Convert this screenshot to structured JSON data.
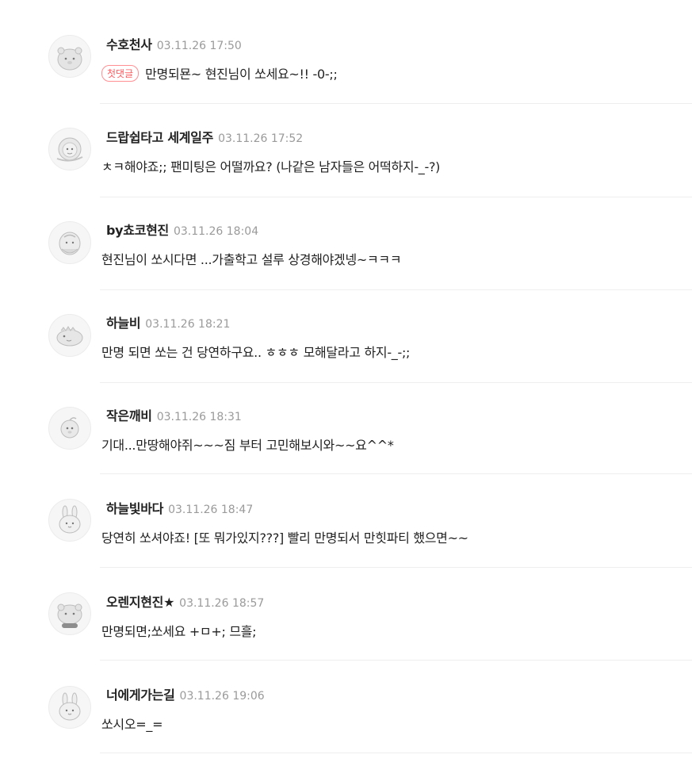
{
  "comments": [
    {
      "nickname": "수호천사",
      "date": "03.11.26 17:50",
      "badge": "첫댓글",
      "text": "만명되묜~ 현진님이 쏘세요~!! -0-;;",
      "avatar_icon": "bear-character-icon"
    },
    {
      "nickname": "드랍쉽타고 세계일주",
      "date": "03.11.26 17:52",
      "text": "ㅊㅋ해야죠;; 팬미팅은 어떨까요? (나같은 남자들은 어떡하지-_-?)",
      "avatar_icon": "lion-character-icon"
    },
    {
      "nickname": "by쵸코현진",
      "date": "03.11.26 18:04",
      "text": "현진님이 쏘시다면 ...가출학고 설루 상경해야겠넹~ㅋㅋㅋ",
      "avatar_icon": "old-man-character-icon"
    },
    {
      "nickname": "하늘비",
      "date": "03.11.26 18:21",
      "text": "만명 되면 쏘는 건 당연하구요.. ㅎㅎㅎ 모해달라고 하지-_-;;",
      "avatar_icon": "dinosaur-character-icon"
    },
    {
      "nickname": "작은깨비",
      "date": "03.11.26 18:31",
      "text": "기대...만땅해야쥐~~~짐 부터 고민해보시와~~요^^*",
      "avatar_icon": "peach-character-icon"
    },
    {
      "nickname": "하늘빛바다",
      "date": "03.11.26 18:47",
      "text": "당연히 쏘셔야죠! [또 뭐가있지???] 빨리 만명되서 만힛파티 했으면~~",
      "avatar_icon": "rabbit-character-icon"
    },
    {
      "nickname": "오렌지현진★",
      "date": "03.11.26 18:57",
      "text": "만명되면;쏘세요 +ㅁ+; 므흘;",
      "avatar_icon": "bear-character-icon"
    },
    {
      "nickname": "너에게가는길",
      "date": "03.11.26 19:06",
      "text": "쏘시오=_=",
      "avatar_icon": "rabbit-character-icon"
    }
  ],
  "colors": {
    "badge": "#ff5a5f",
    "date": "#9a9a9a",
    "divider": "#eeeeee"
  }
}
